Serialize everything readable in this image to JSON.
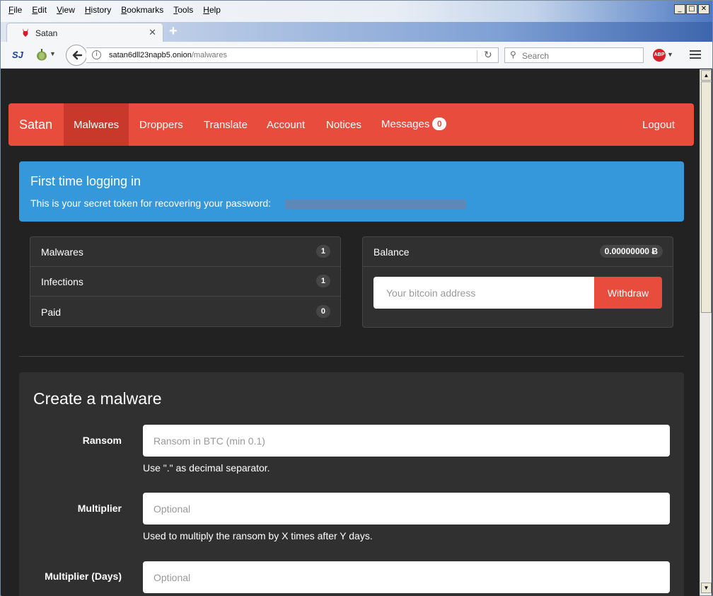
{
  "browser": {
    "menu": [
      "File",
      "Edit",
      "View",
      "History",
      "Bookmarks",
      "Tools",
      "Help"
    ],
    "tab_title": "Satan",
    "url_host": "satan6dll23napb5.onion",
    "url_path": "/malwares",
    "search_placeholder": "Search",
    "addon_sj": "SJ",
    "abp_label": "ABP"
  },
  "nav": {
    "brand": "Satan",
    "items": [
      "Malwares",
      "Droppers",
      "Translate",
      "Account",
      "Notices",
      "Messages"
    ],
    "messages_count": "0",
    "logout": "Logout"
  },
  "alert": {
    "title": "First time logging in",
    "text": "This is your secret token for recovering your password:"
  },
  "stats": [
    {
      "label": "Malwares",
      "count": "1"
    },
    {
      "label": "Infections",
      "count": "1"
    },
    {
      "label": "Paid",
      "count": "0"
    }
  ],
  "balance": {
    "label": "Balance",
    "amount": "0.00000000",
    "currency_symbol": "Ƀ",
    "address_placeholder": "Your bitcoin address",
    "withdraw_label": "Withdraw"
  },
  "create": {
    "title": "Create a malware",
    "ransom_label": "Ransom",
    "ransom_placeholder": "Ransom in BTC (min 0.1)",
    "ransom_help": "Use \".\" as decimal separator.",
    "multiplier_label": "Multiplier",
    "multiplier_placeholder": "Optional",
    "multiplier_help": "Used to multiply the ransom by X times after Y days.",
    "days_label": "Multiplier (Days)",
    "days_placeholder": "Optional"
  },
  "colors": {
    "navbar": "#e74c3c",
    "alert": "#3498db",
    "panel": "#303030",
    "background": "#222222"
  }
}
